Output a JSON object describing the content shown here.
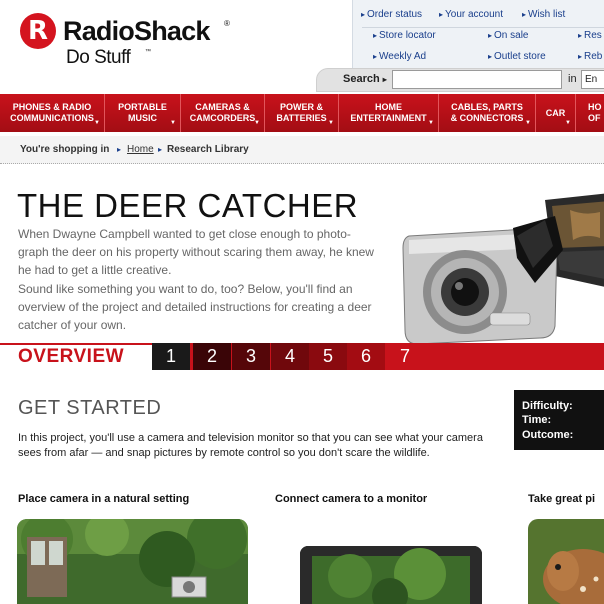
{
  "header": {
    "logo_letter": "R",
    "brand": "RadioShack",
    "reg_mark": "®",
    "tagline": "Do Stuff",
    "tagline_mark": "™",
    "utility_links": [
      {
        "label": "Order status"
      },
      {
        "label": "Your account"
      },
      {
        "label": "Wish list"
      },
      {
        "label": "Store locator"
      },
      {
        "label": "On sale"
      },
      {
        "label": "Res"
      },
      {
        "label": "Weekly Ad"
      },
      {
        "label": "Outlet store"
      },
      {
        "label": "Reb"
      }
    ],
    "search": {
      "label": "Search",
      "value": "",
      "in_label": "in",
      "scope_value": "En"
    }
  },
  "nav": {
    "items": [
      {
        "label": "PHONES & RADIO\nCOMMUNICATIONS"
      },
      {
        "label": "PORTABLE\nMUSIC"
      },
      {
        "label": "CAMERAS &\nCAMCORDERS"
      },
      {
        "label": "POWER &\nBATTERIES"
      },
      {
        "label": "HOME\nENTERTAINMENT"
      },
      {
        "label": "CABLES, PARTS\n& CONNECTORS"
      },
      {
        "label": "CAR"
      },
      {
        "label": "HO\nOF"
      }
    ]
  },
  "breadcrumb": {
    "prefix": "You're shopping in",
    "home": "Home",
    "current": "Research Library"
  },
  "hero": {
    "title": "THE DEER CATCHER",
    "para1": "When Dwayne Campbell wanted to get close enough to photo-graph the deer on his property without scaring them away, he knew he had to get a little creative.",
    "para2": "Sound like something you want to do, too? Below, you'll find an overview of the project and detailed instructions for creating a deer catcher of your own."
  },
  "tabs": {
    "overview": "OVERVIEW",
    "numbers": [
      "1",
      "2",
      "3",
      "4",
      "5",
      "6",
      "7"
    ],
    "colors": [
      "#1a1a1a",
      "#3a0507",
      "#550609",
      "#70080c",
      "#8a0a0f",
      "#a30c12",
      "#c8121b"
    ]
  },
  "get_started": {
    "title": "GET STARTED",
    "paragraph": "In this project, you'll use a camera and television monitor so that you can see what your camera sees from afar — and snap pictures by remote control so you don't scare the wildlife.",
    "info": {
      "difficulty": "Difficulty:",
      "time": "Time:",
      "outcome": "Outcome:"
    }
  },
  "steps": [
    {
      "title": "Place camera in a natural setting"
    },
    {
      "title": "Connect camera to a monitor"
    },
    {
      "title": "Take great pi"
    }
  ],
  "colors": {
    "brand_red": "#c8121b",
    "link_blue": "#1a3f8c"
  },
  "icons": {
    "arrow": "▸",
    "caret": "▼"
  }
}
